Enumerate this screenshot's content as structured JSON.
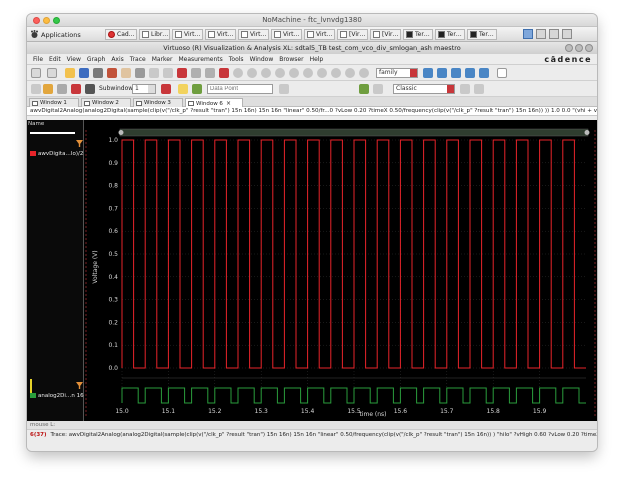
{
  "mac": {
    "title": "NoMachine - ftc_lvnvdg1380"
  },
  "taskbar": {
    "apps_label": "Applications",
    "items": [
      "Cad…",
      "Libr…",
      "Virt…",
      "Virt…",
      "Virt…",
      "Virt…",
      "Virt…",
      "[Vir…",
      "[Vir…",
      "Ter…",
      "Ter…",
      "Ter…"
    ]
  },
  "app": {
    "title": "Virtuoso (R) Visualization & Analysis XL: sdtal5_TB test_com_vco_div_smlogan_ash maestro",
    "brand": "cādence"
  },
  "menu": [
    "File",
    "Edit",
    "View",
    "Graph",
    "Axis",
    "Trace",
    "Marker",
    "Measurements",
    "Tools",
    "Window",
    "Browser",
    "Help"
  ],
  "toolbar": {
    "family_value": "family",
    "subwindow_label": "Subwindow",
    "subwindow_value": "1",
    "datapoint_placeholder": "Data Point",
    "style_value": "Classic"
  },
  "tabs": [
    {
      "label": "Window 1"
    },
    {
      "label": "Window 2"
    },
    {
      "label": "Window 3"
    },
    {
      "label": "Window 6",
      "close": "×"
    }
  ],
  "expression": "awvDigital2Analog(analog2Digital(sample(clip(v(\"/clk_p\" ?result \"tran\") 15n 16n) 15n 16n \"linear\" 0.50/fr...0 ?vLow 0.20 ?timeX 0.50/frequency(clip(v(\"/clk_p\" ?result \"tran\") 15n 16n)) )) 1.0 0.0 \"(vhi + vlo)/2.0\")",
  "legend": {
    "header": "Name",
    "top_entry": "awvDigita…lo)/2.0\")",
    "bottom_entry": "analog2Di…n 16n))"
  },
  "colors": {
    "top_trace": "#e8242a",
    "bottom_trace": "#2a9d3c",
    "background": "#000000"
  },
  "chart_data": {
    "type": "line",
    "xlabel": "time (ns)",
    "ylabel": "Voltage (V)",
    "xlim": [
      15.0,
      16.0
    ],
    "x_ticks": [
      "15.0",
      "15.1",
      "15.2",
      "15.3",
      "15.4",
      "15.5",
      "15.6",
      "15.7",
      "15.8",
      "15.9"
    ],
    "ylim": [
      0.0,
      1.0
    ],
    "y_ticks": [
      "0.0",
      "0.1",
      "0.2",
      "0.3",
      "0.4",
      "0.5",
      "0.6",
      "0.7",
      "0.8",
      "0.9",
      "1.0"
    ],
    "grid": true,
    "series": [
      {
        "name": "awvDigita…lo)/2.0\")",
        "waveform": "square",
        "period_ns": 0.05,
        "high_v": 1.0,
        "low_v": 0.0,
        "first_rise_ns": 15.0,
        "duty": 0.5
      },
      {
        "name": "analog2Di…n 16n))",
        "waveform": "square",
        "period_ns": 0.05,
        "first_rise_ns": 15.0,
        "duty": 0.7
      }
    ]
  },
  "status": {
    "line1": "mouse L:",
    "number": "6(37)",
    "line2": "Trace: awvDigital2Analog(analog2Digital(sample(clip(v(\"/clk_p\" ?result \"tran\") 15n 16n) 15n 16n \"linear\" 0.50/frequency(clip(v(\"/clk_p\" ?result \"tran\") 15n 16n)) ) \"hilo\" ?vHigh 0.60 ?vLow 0.20 ?timeX 0.50/frequency(clip(v(\"/clk_p\" ?result \"tra"
  }
}
